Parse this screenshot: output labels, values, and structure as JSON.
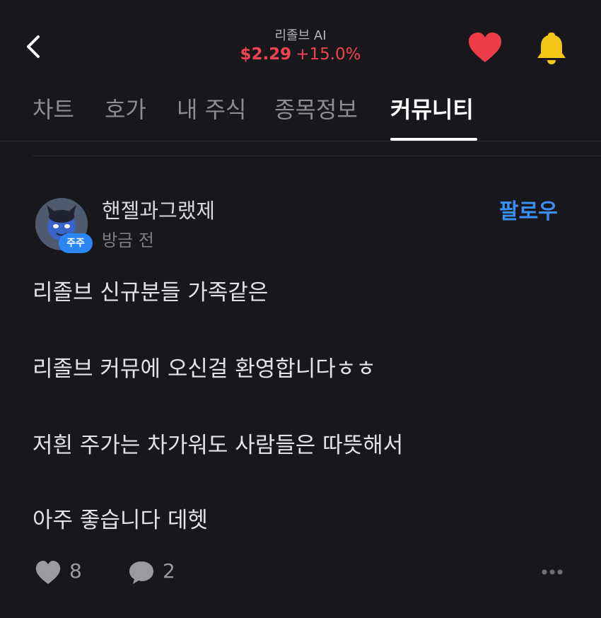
{
  "header": {
    "back_icon": "chevron-left-icon",
    "stock_name": "리졸브 AI",
    "price": "$2.29",
    "change": "+15.0%",
    "price_color": "#f04452",
    "heart_icon": "heart-icon",
    "heart_color": "#ee3b48",
    "bell_icon": "bell-icon",
    "bell_color": "#f5c518"
  },
  "tabs": [
    {
      "label": "차트",
      "active": false
    },
    {
      "label": "호가",
      "active": false
    },
    {
      "label": "내 주식",
      "active": false
    },
    {
      "label": "종목정보",
      "active": false
    },
    {
      "label": "커뮤니티",
      "active": true
    }
  ],
  "post": {
    "author": "핸젤과그랬제",
    "badge": "주주",
    "badge_color": "#2b86f5",
    "time": "방금 전",
    "follow_label": "팔로우",
    "follow_color": "#3a8ff7",
    "lines": [
      "리졸브 신규분들 가족같은",
      "리졸브 커뮤에 오신걸 환영합니다ㅎㅎ",
      "저흰 주가는 차가워도 사람들은 따뜻해서",
      "아주 좋습니다 데헷"
    ],
    "likes": "8",
    "comments": "2",
    "like_icon": "heart-icon",
    "comment_icon": "speech-bubble-icon",
    "more_icon": "more-horizontal-icon"
  }
}
